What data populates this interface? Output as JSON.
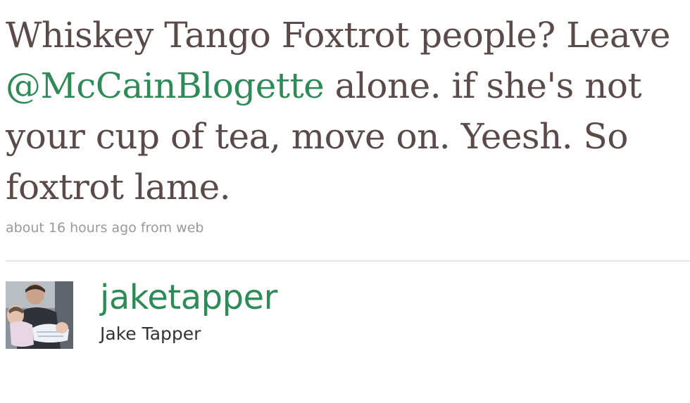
{
  "tweet": {
    "text_before": "Whiskey Tango Foxtrot people? Leave ",
    "mention": "@McCainBlogette",
    "text_after": " alone. if she's not your cup of tea, move on. Yeesh. So foxtrot lame.",
    "timestamp": "about 16 hours ago",
    "from_label": " from ",
    "source": "web"
  },
  "author": {
    "username": "jaketapper",
    "full_name": "Jake Tapper",
    "avatar_icon": "user-photo-avatar"
  },
  "colors": {
    "text": "#5b4a4a",
    "link": "#2e8b57",
    "meta": "#999999",
    "divider": "#e6e6e6"
  }
}
